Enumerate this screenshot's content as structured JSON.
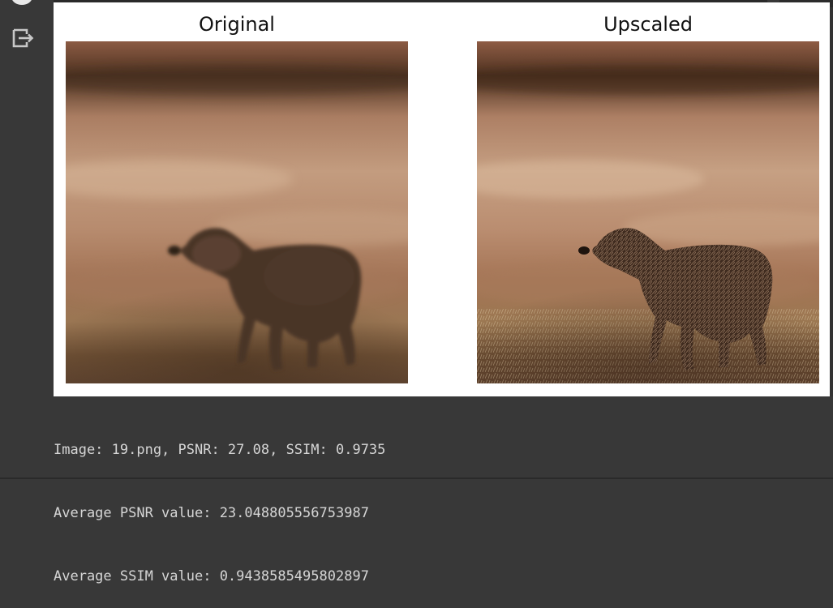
{
  "figure": {
    "panels": [
      {
        "title": "Original"
      },
      {
        "title": "Upscaled"
      }
    ]
  },
  "console": {
    "lines": [
      "Image: 19.png, PSNR: 27.08, SSIM: 0.9735",
      "Average PSNR value: 23.048805556753987",
      "Average SSIM value: 0.9438585495802897"
    ]
  },
  "icons": {
    "gutter": "output-clear-icon",
    "run": "run-status-icon"
  },
  "colors": {
    "background": "#383838",
    "figure_background": "#ffffff",
    "console_text": "#d6d6d6"
  }
}
